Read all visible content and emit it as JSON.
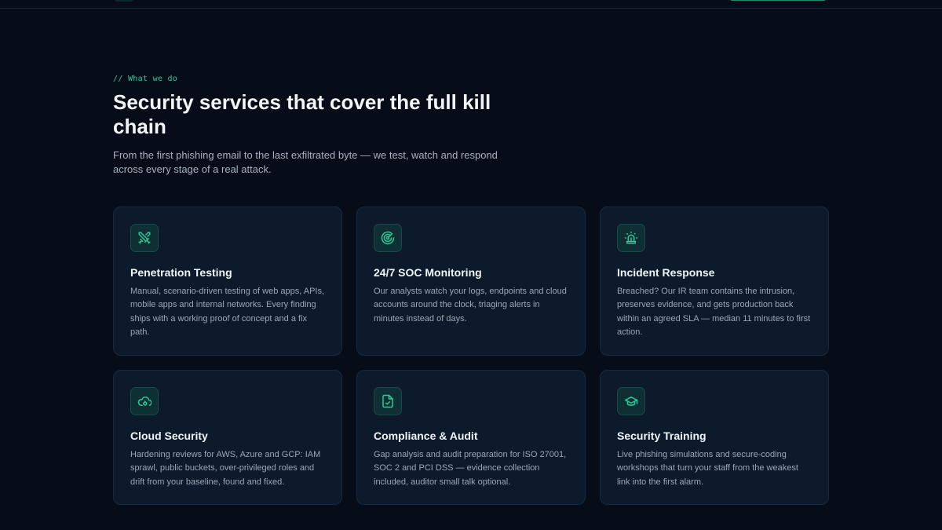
{
  "section": {
    "eyebrow": "// What we do",
    "title": "Security services that cover the full kill chain",
    "lead": "From the first phishing email to the last exfiltrated byte — we test, watch and respond across every stage of a real attack."
  },
  "services": [
    {
      "icon": "crossed-swords-icon",
      "title": "Penetration Testing",
      "description": "Manual, scenario-driven testing of web apps, APIs, mobile apps and internal networks. Every finding ships with a working proof of concept and a fix path."
    },
    {
      "icon": "radar-icon",
      "title": "24/7 SOC Monitoring",
      "description": "Our analysts watch your logs, endpoints and cloud accounts around the clock, triaging alerts in minutes instead of days."
    },
    {
      "icon": "siren-icon",
      "title": "Incident Response",
      "description": "Breached? Our IR team contains the intrusion, preserves evidence, and gets production back within an agreed SLA — median 11 minutes to first action."
    },
    {
      "icon": "cloud-lock-icon",
      "title": "Cloud Security",
      "description": "Hardening reviews for AWS, Azure and GCP: IAM sprawl, public buckets, over-privileged roles and drift from your baseline, found and fixed."
    },
    {
      "icon": "file-check-icon",
      "title": "Compliance & Audit",
      "description": "Gap analysis and audit preparation for ISO 27001, SOC 2 and PCI DSS — evidence collection included, auditor small talk optional."
    },
    {
      "icon": "graduation-cap-icon",
      "title": "Security Training",
      "description": "Live phishing simulations and secure-coding workshops that turn your staff from the weakest link into the first alarm."
    }
  ],
  "colors": {
    "accent": "#2fc99a",
    "background": "#060d18",
    "card": "#0c1a2b"
  }
}
